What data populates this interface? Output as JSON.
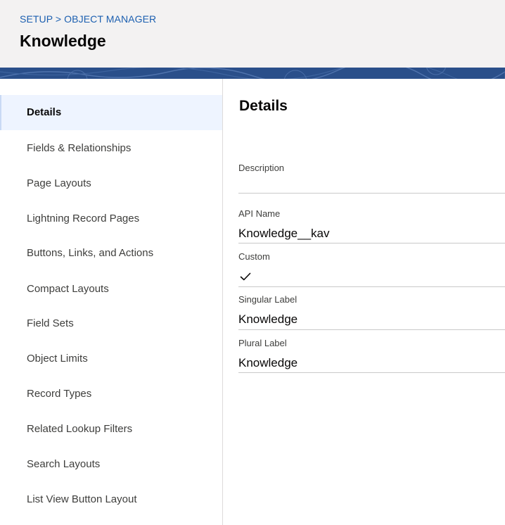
{
  "header": {
    "breadcrumb": "SETUP > OBJECT MANAGER",
    "title": "Knowledge"
  },
  "sidebar": {
    "items": [
      {
        "label": "Details",
        "active": true
      },
      {
        "label": "Fields & Relationships"
      },
      {
        "label": "Page Layouts"
      },
      {
        "label": "Lightning Record Pages"
      },
      {
        "label": "Buttons, Links, and Actions"
      },
      {
        "label": "Compact Layouts"
      },
      {
        "label": "Field Sets"
      },
      {
        "label": "Object Limits"
      },
      {
        "label": "Record Types"
      },
      {
        "label": "Related Lookup Filters"
      },
      {
        "label": "Search Layouts"
      },
      {
        "label": "List View Button Layout"
      }
    ]
  },
  "details": {
    "title": "Details",
    "description": {
      "label": "Description",
      "value": ""
    },
    "api_name": {
      "label": "API Name",
      "value": "Knowledge__kav"
    },
    "custom": {
      "label": "Custom",
      "icon": "check-icon"
    },
    "singular_label": {
      "label": "Singular Label",
      "value": "Knowledge"
    },
    "plural_label": {
      "label": "Plural Label",
      "value": "Knowledge"
    }
  },
  "colors": {
    "link": "#1b5fb0",
    "banner": "#2a4f8a",
    "active_nav_bg": "#eef4ff"
  }
}
